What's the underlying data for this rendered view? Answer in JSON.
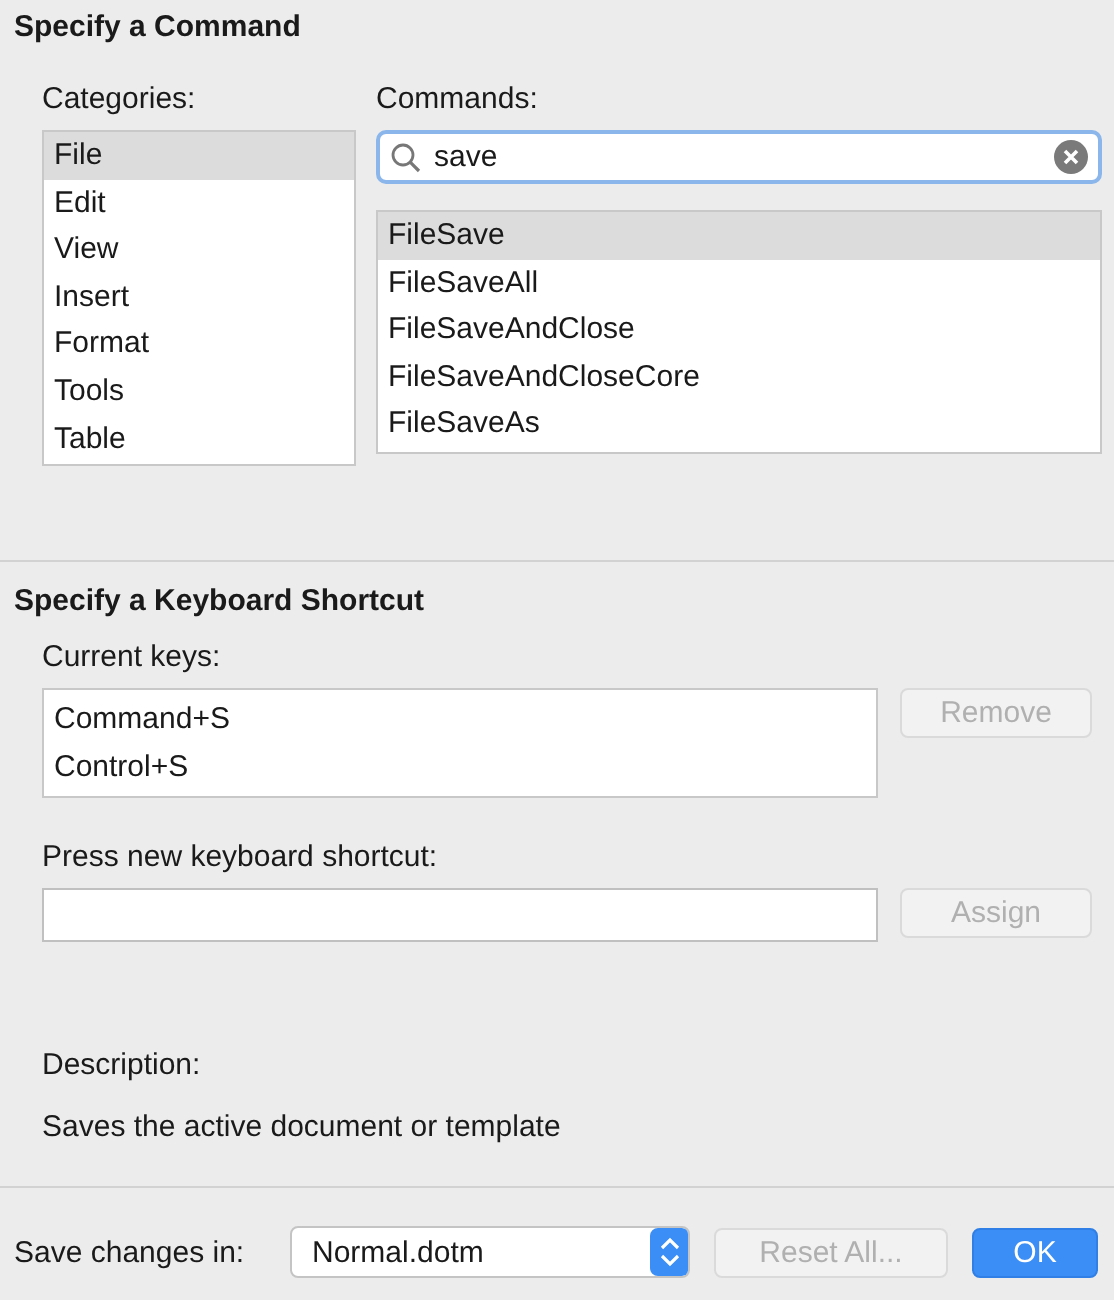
{
  "command_section": {
    "title": "Specify a Command",
    "categories": {
      "label": "Categories:",
      "items": [
        {
          "label": "File",
          "selected": true
        },
        {
          "label": "Edit",
          "selected": false
        },
        {
          "label": "View",
          "selected": false
        },
        {
          "label": "Insert",
          "selected": false
        },
        {
          "label": "Format",
          "selected": false
        },
        {
          "label": "Tools",
          "selected": false
        },
        {
          "label": "Table",
          "selected": false
        }
      ]
    },
    "commands": {
      "label": "Commands:",
      "search": {
        "value": "save"
      },
      "items": [
        {
          "label": "FileSave",
          "selected": true
        },
        {
          "label": "FileSaveAll",
          "selected": false
        },
        {
          "label": "FileSaveAndClose",
          "selected": false
        },
        {
          "label": "FileSaveAndCloseCore",
          "selected": false
        },
        {
          "label": "FileSaveAs",
          "selected": false
        }
      ]
    }
  },
  "shortcut_section": {
    "title": "Specify a Keyboard Shortcut",
    "current_keys": {
      "label": "Current keys:",
      "items": [
        "Command+S",
        "Control+S"
      ],
      "button": {
        "label": "Remove",
        "disabled": true
      }
    },
    "new_shortcut": {
      "label": "Press new keyboard shortcut:",
      "button": {
        "label": "Assign",
        "disabled": true
      }
    },
    "description": {
      "label": "Description:",
      "text": "Saves the active document or template"
    }
  },
  "footer": {
    "label": "Save changes in:",
    "select": {
      "value": "Normal.dotm"
    },
    "buttons": [
      {
        "label": "Reset All...",
        "kind": "normal",
        "disabled": true
      },
      {
        "label": "OK",
        "kind": "primary",
        "disabled": false
      }
    ]
  }
}
